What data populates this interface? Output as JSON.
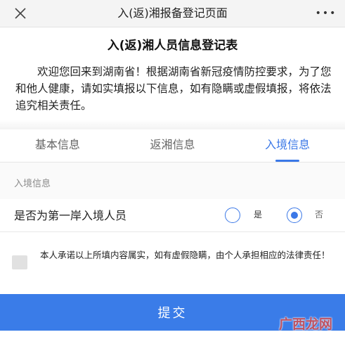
{
  "topbar": {
    "title": "入(返)湘报备登记页面",
    "close_icon": "close-icon",
    "more_icon": "more-dots-icon",
    "more_glyph": "•••"
  },
  "form": {
    "title": "入(返)湘人员信息登记表",
    "intro": "欢迎您回来到湖南省！根据湖南省新冠疫情防控要求，为了您和他人健康，请如实填报以下信息，如有隐瞒或虚假填报，将依法追究相关责任。"
  },
  "tabs": [
    {
      "label": "基本信息",
      "active": false
    },
    {
      "label": "返湘信息",
      "active": false
    },
    {
      "label": "入境信息",
      "active": true
    }
  ],
  "section": {
    "label": "入境信息",
    "question": "是否为第一岸入境人员",
    "options": [
      {
        "label": "是",
        "selected": false
      },
      {
        "label": "否",
        "selected": true
      }
    ]
  },
  "agreement": {
    "checked": false,
    "text": "本人承诺以上所填内容属实，如有虚假隐瞒，由个人承担相应的法律责任！"
  },
  "submit": {
    "label": "提交"
  },
  "watermark": {
    "text": "广西龙网"
  },
  "colors": {
    "accent": "#3b78e7",
    "button": "#3a7ce8",
    "watermark": "#d54b4b"
  }
}
